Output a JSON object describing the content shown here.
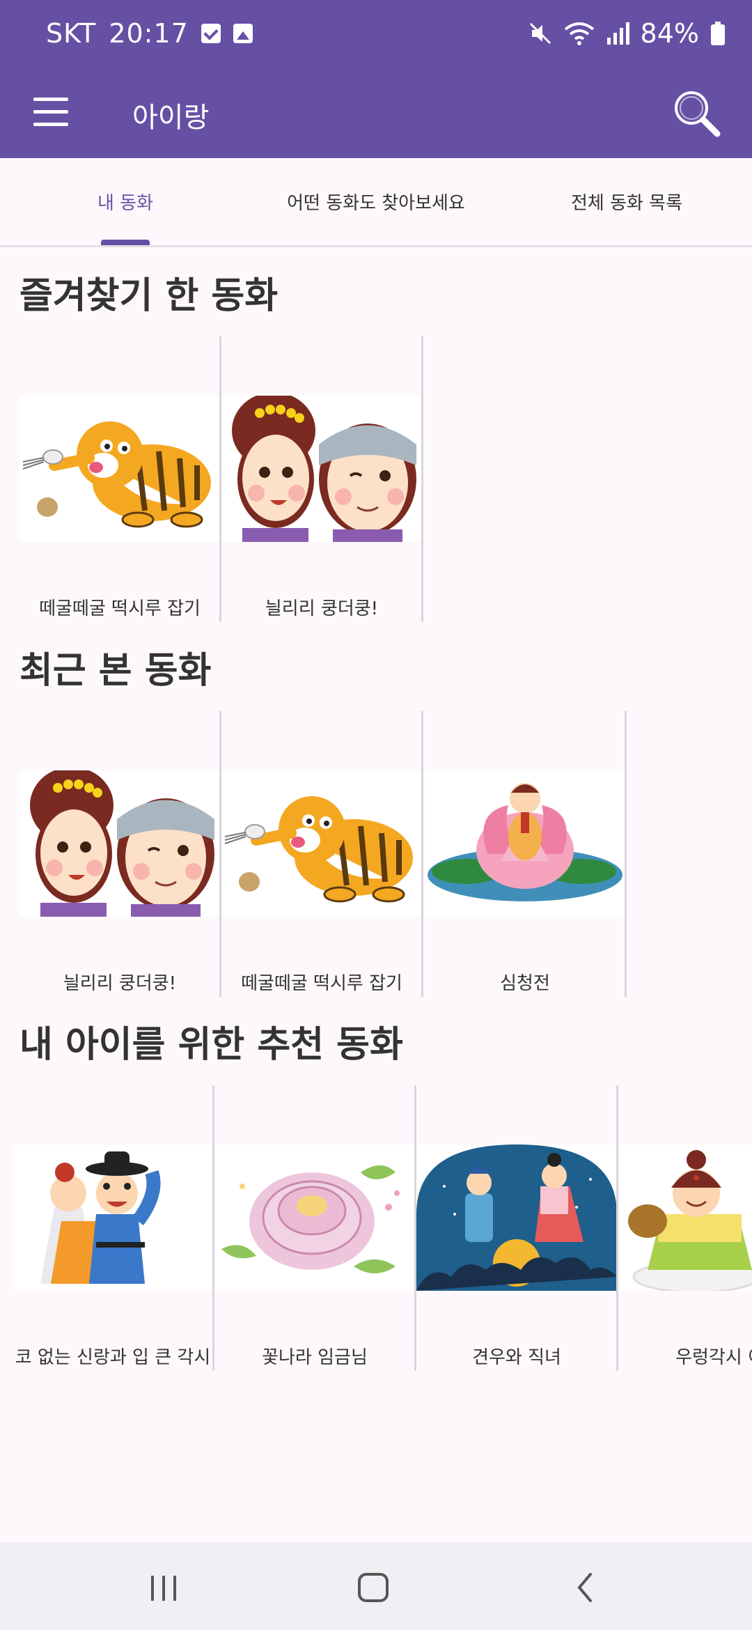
{
  "status_bar": {
    "carrier": "SKT",
    "time": "20:17",
    "battery": "84%"
  },
  "app_bar": {
    "title": "아이랑",
    "menu_icon": "menu-icon",
    "search_icon": "search-icon"
  },
  "tabs": [
    {
      "label": "내 동화",
      "active": true
    },
    {
      "label": "어떤 동화도 찾아보세요",
      "active": false
    },
    {
      "label": "전체 동화 목록",
      "active": false
    }
  ],
  "sections": {
    "favorites": {
      "title": "즐겨찾기 한 동화",
      "items": [
        {
          "title": "떼굴떼굴 떡시루 잡기",
          "image": "tiger"
        },
        {
          "title": "늴리리 쿵더쿵!",
          "image": "couple"
        }
      ]
    },
    "recent": {
      "title": "최근 본 동화",
      "items": [
        {
          "title": "늴리리 쿵더쿵!",
          "image": "couple"
        },
        {
          "title": "떼굴떼굴 떡시루 잡기",
          "image": "tiger"
        },
        {
          "title": "심청전",
          "image": "lotus"
        }
      ]
    },
    "recommended": {
      "title": "내 아이를 위한 추천 동화",
      "items": [
        {
          "title": "코 없는 신랑과 입 큰 각시",
          "image": "bride-groom"
        },
        {
          "title": "꽃나라 임금님",
          "image": "peony"
        },
        {
          "title": "견우와 직녀",
          "image": "gyeonwoo"
        },
        {
          "title": "우렁각시 이",
          "image": "snail-bride"
        }
      ]
    }
  },
  "colors": {
    "primary": "#6650a4",
    "background": "#fdf8fc",
    "divider": "#d8d5dc"
  }
}
